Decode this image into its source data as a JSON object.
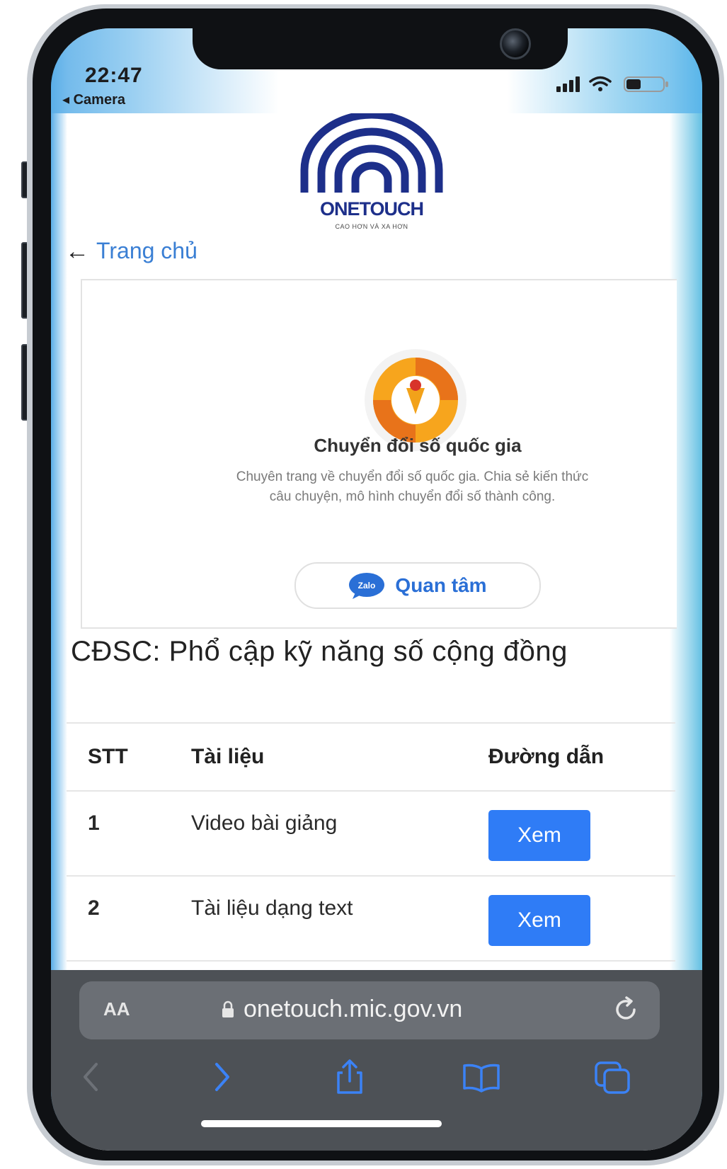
{
  "status_bar": {
    "time": "22:47",
    "back_app": "◂ Camera"
  },
  "logo": {
    "name": "ONETOUCH",
    "tagline": "CAO HƠN VÀ XA HƠN",
    "color": "#1d2f8a"
  },
  "nav": {
    "back_label": "Trang chủ"
  },
  "card": {
    "title": "Chuyển đổi số quốc gia",
    "description_line1": "Chuyên trang về chuyển đổi số quốc gia. Chia sẻ kiến thức",
    "description_line2": "câu chuyện, mô hình chuyển đổi số thành công.",
    "follow_label": "Quan tâm",
    "zalo_icon_text": "Zalo"
  },
  "section": {
    "heading": "CĐSC: Phổ cập kỹ năng số cộng đồng"
  },
  "table": {
    "headers": [
      "STT",
      "Tài liệu",
      "Đường dẫn"
    ],
    "rows": [
      {
        "stt": "1",
        "doc": "Video bài giảng",
        "action": "Xem"
      },
      {
        "stt": "2",
        "doc": "Tài liệu dạng text",
        "action": "Xem"
      }
    ]
  },
  "browser": {
    "aa_label": "AA",
    "url": "onetouch.mic.gov.vn"
  },
  "colors": {
    "accent": "#2f7cf6",
    "link": "#3a7fd4",
    "safari_bar": "#4d5156"
  }
}
